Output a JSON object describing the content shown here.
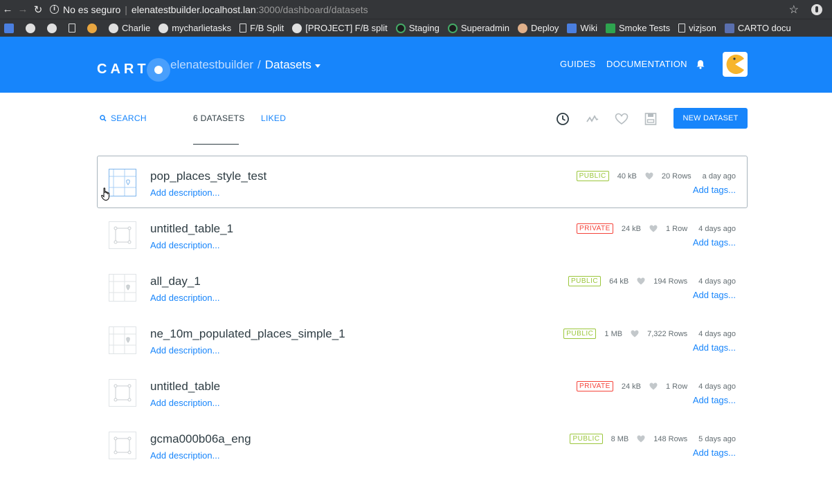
{
  "browser": {
    "insecure_label": "No es seguro",
    "url_host": "elenatestbuilder.localhost.lan",
    "url_path": ":3000/dashboard/datasets"
  },
  "bookmarks": [
    {
      "label": "",
      "icon": "calendar-icon"
    },
    {
      "label": "",
      "icon": "github-icon"
    },
    {
      "label": "",
      "icon": "gear-icon"
    },
    {
      "label": "",
      "icon": "page-icon"
    },
    {
      "label": "",
      "icon": "brush-icon"
    },
    {
      "label": "Charlie",
      "icon": "github-icon"
    },
    {
      "label": "mycharlietasks",
      "icon": "github-icon"
    },
    {
      "label": "F/B Split",
      "icon": "page-icon"
    },
    {
      "label": "[PROJECT] F/B split",
      "icon": "github-icon"
    },
    {
      "label": "Staging",
      "icon": "carto-icon"
    },
    {
      "label": "Superadmin",
      "icon": "carto-icon"
    },
    {
      "label": "Deploy",
      "icon": "face-icon"
    },
    {
      "label": "Wiki",
      "icon": "trello-icon"
    },
    {
      "label": "Smoke Tests",
      "icon": "sheets-icon"
    },
    {
      "label": "vizjson",
      "icon": "page-icon"
    },
    {
      "label": "CARTO docu",
      "icon": "doc-icon"
    }
  ],
  "header": {
    "logo_text": "CART",
    "username": "elenatestbuilder",
    "separator": "/",
    "section": "Datasets",
    "guides": "GUIDES",
    "documentation": "DOCUMENTATION",
    "brand_color": "#1785fb"
  },
  "filters": {
    "search": "SEARCH",
    "datasets_tab": "6 DATASETS",
    "liked_tab": "LIKED",
    "new_button": "NEW DATASET"
  },
  "datasets": [
    {
      "name": "pop_places_style_test",
      "desc": "Add description...",
      "privacy": "PUBLIC",
      "size": "40 kB",
      "rows": "20 Rows",
      "date": "a day ago",
      "tags": "Add tags...",
      "thumb": "map"
    },
    {
      "name": "untitled_table_1",
      "desc": "Add description...",
      "privacy": "PRIVATE",
      "size": "24 kB",
      "rows": "1 Row",
      "date": "4 days ago",
      "tags": "Add tags...",
      "thumb": "empty"
    },
    {
      "name": "all_day_1",
      "desc": "Add description...",
      "privacy": "PUBLIC",
      "size": "64 kB",
      "rows": "194 Rows",
      "date": "4 days ago",
      "tags": "Add tags...",
      "thumb": "map"
    },
    {
      "name": "ne_10m_populated_places_simple_1",
      "desc": "Add description...",
      "privacy": "PUBLIC",
      "size": "1 MB",
      "rows": "7,322 Rows",
      "date": "4 days ago",
      "tags": "Add tags...",
      "thumb": "map"
    },
    {
      "name": "untitled_table",
      "desc": "Add description...",
      "privacy": "PRIVATE",
      "size": "24 kB",
      "rows": "1 Row",
      "date": "4 days ago",
      "tags": "Add tags...",
      "thumb": "empty"
    },
    {
      "name": "gcma000b06a_eng",
      "desc": "Add description...",
      "privacy": "PUBLIC",
      "size": "8 MB",
      "rows": "148 Rows",
      "date": "5 days ago",
      "tags": "Add tags...",
      "thumb": "empty"
    }
  ]
}
